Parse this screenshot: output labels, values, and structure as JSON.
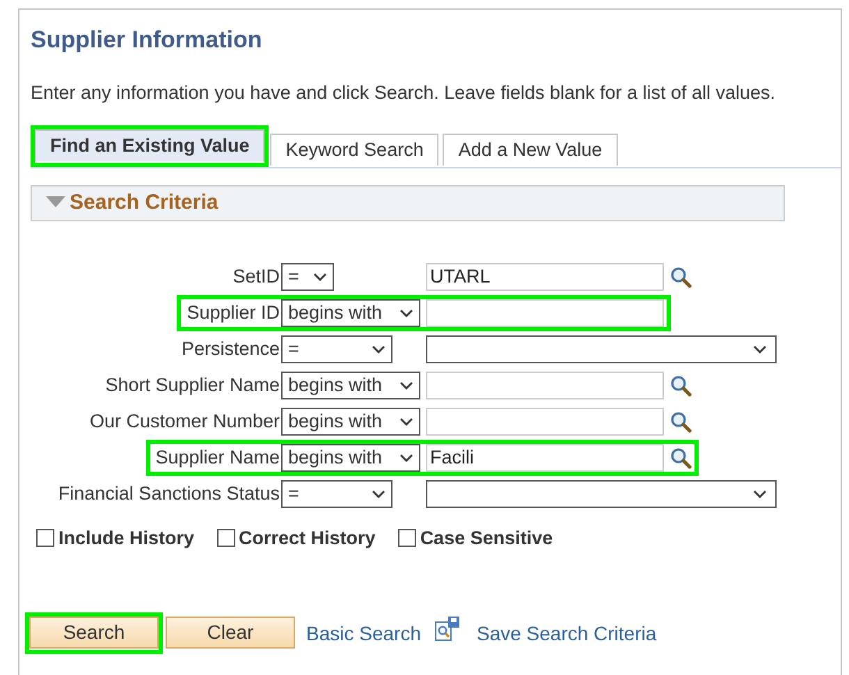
{
  "title": "Supplier Information",
  "instructions": "Enter any information you have and click Search. Leave fields blank for a list of all values.",
  "tabs": [
    {
      "label": "Find an Existing Value",
      "selected": true,
      "highlighted": true
    },
    {
      "label": "Keyword Search",
      "selected": false,
      "highlighted": false
    },
    {
      "label": "Add a New Value",
      "selected": false,
      "highlighted": false
    }
  ],
  "section": {
    "title": "Search Criteria",
    "expanded": true
  },
  "fields": [
    {
      "kind": "key",
      "label": "SetID",
      "operator": "=",
      "value": "UTARL",
      "highlighted": false
    },
    {
      "kind": "lookup-plain",
      "label": "Supplier ID",
      "operator": "begins with",
      "highlighted": true
    },
    {
      "kind": "select",
      "label": "Persistence",
      "operator": "=",
      "highlighted": false
    },
    {
      "kind": "lookup",
      "label": "Short Supplier Name",
      "operator": "begins with",
      "highlighted": false
    },
    {
      "kind": "lookup",
      "label": "Our Customer Number",
      "operator": "begins with",
      "highlighted": false
    },
    {
      "kind": "lookup",
      "label": "Supplier Name",
      "operator": "begins with",
      "value": "Facili",
      "highlighted": true
    },
    {
      "kind": "select",
      "label": "Financial Sanctions Status",
      "operator": "=",
      "highlighted": false
    }
  ],
  "options": [
    {
      "label": "Include History",
      "checked": false
    },
    {
      "label": "Correct History",
      "checked": false
    },
    {
      "label": "Case Sensitive",
      "checked": false
    }
  ],
  "buttons": [
    {
      "label": "Search",
      "highlighted": true
    },
    {
      "label": "Clear",
      "highlighted": false
    }
  ],
  "links": {
    "basic": "Basic Search",
    "save": "Save Search Criteria"
  }
}
